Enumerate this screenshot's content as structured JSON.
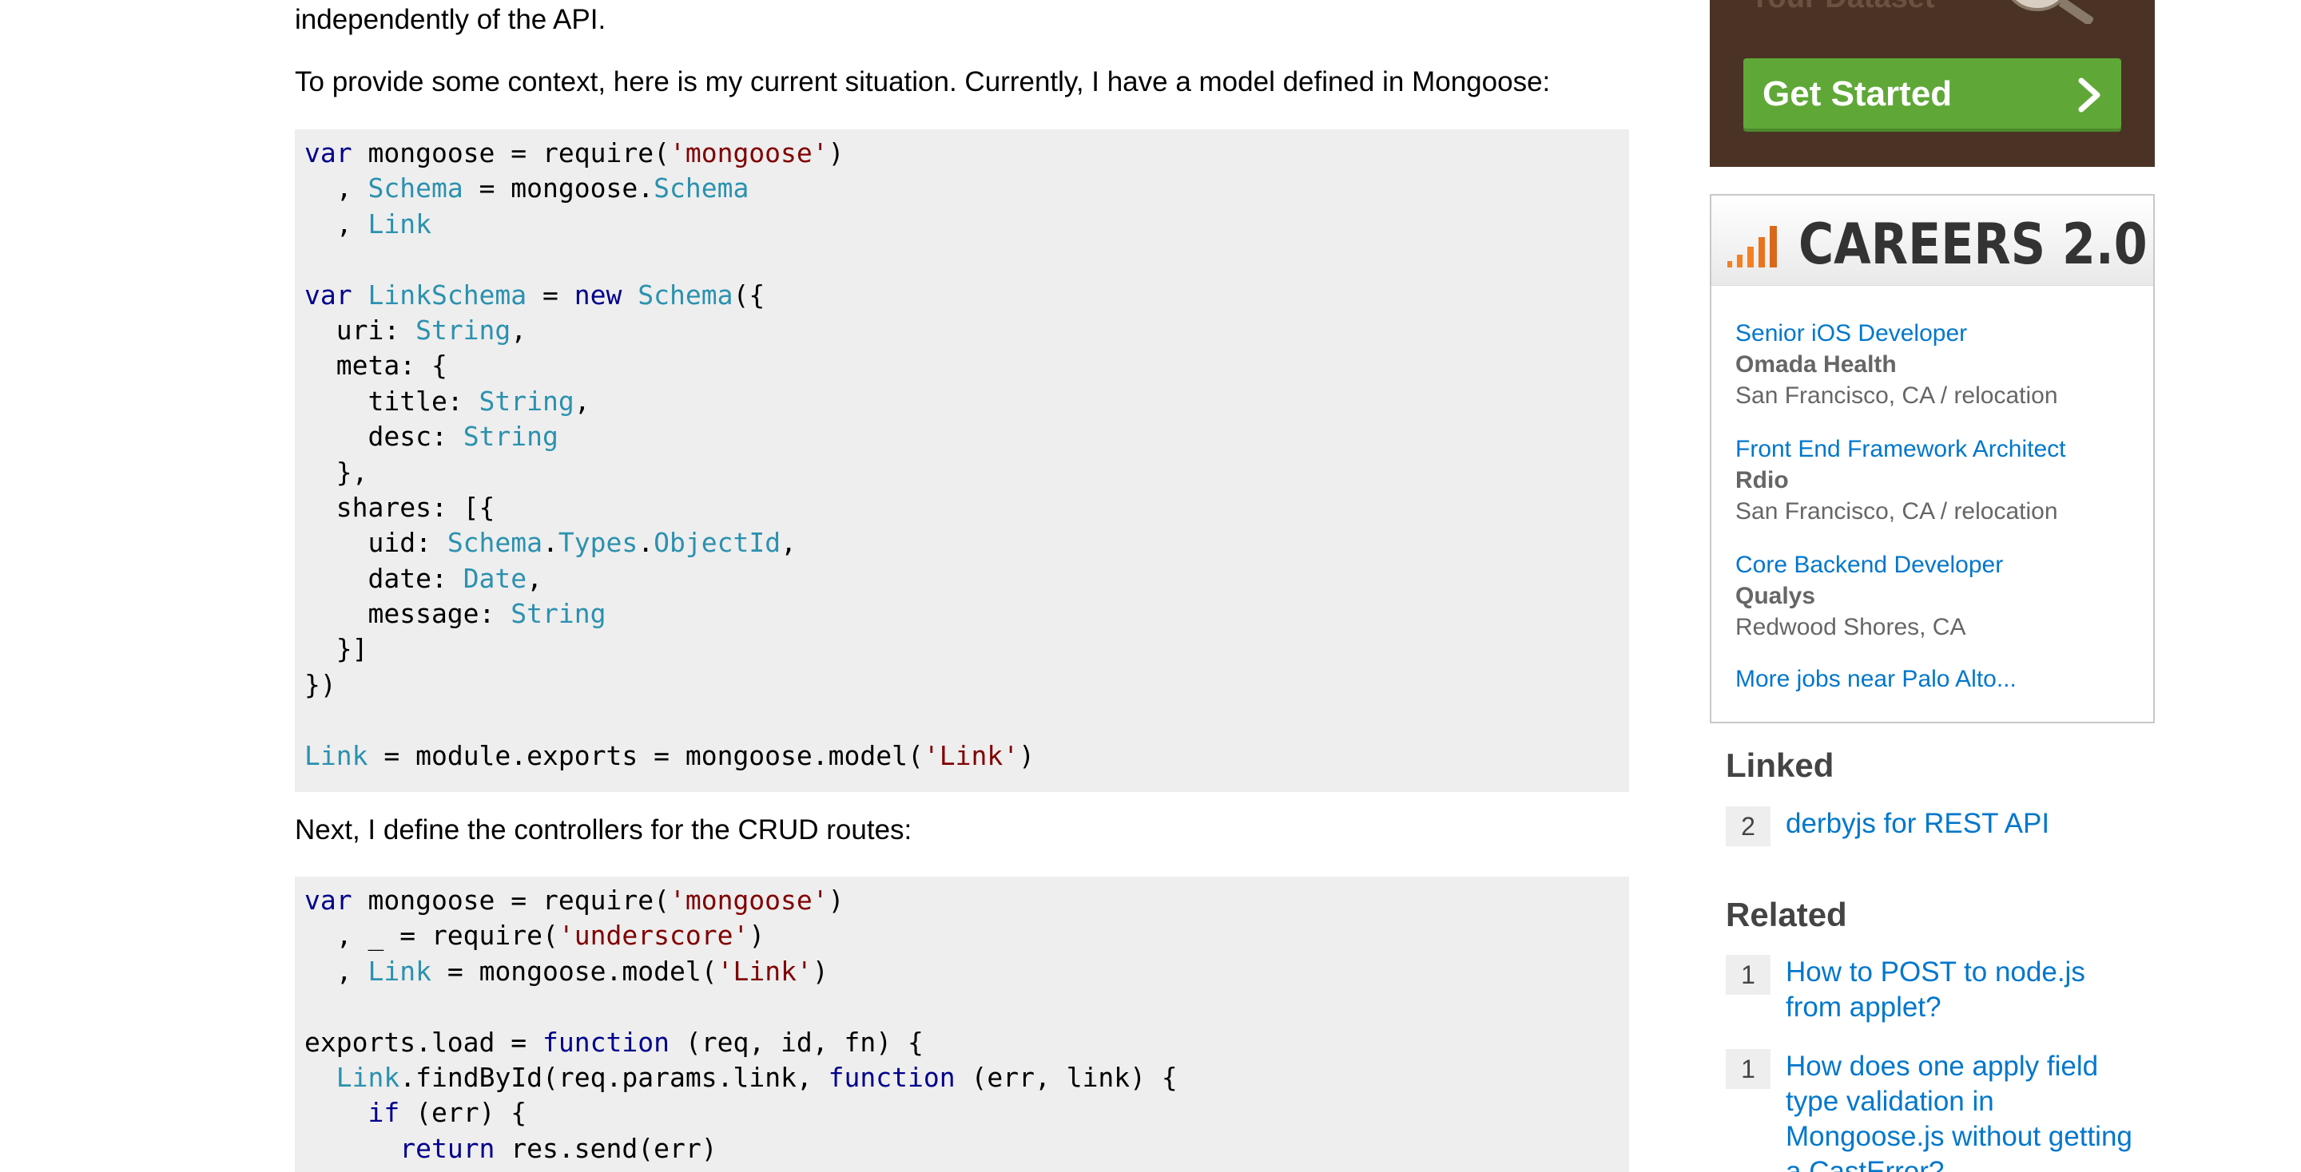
{
  "question": {
    "intro_tail": "independently of the API.",
    "context_paragraph": "To provide some context, here is my current situation. Currently, I have a model defined in Mongoose:",
    "controllers_paragraph": "Next, I define the controllers for the CRUD routes:"
  },
  "code_block_model": {
    "lines": [
      [
        [
          "kw",
          "var"
        ],
        [
          "p",
          " mongoose = require("
        ],
        [
          "str",
          "'mongoose'"
        ],
        [
          "p",
          ")"
        ]
      ],
      [
        [
          "p",
          "  , "
        ],
        [
          "ty",
          "Schema"
        ],
        [
          "p",
          " = mongoose."
        ],
        [
          "ty",
          "Schema"
        ]
      ],
      [
        [
          "p",
          "  , "
        ],
        [
          "ty",
          "Link"
        ]
      ],
      [],
      [
        [
          "kw",
          "var"
        ],
        [
          "p",
          " "
        ],
        [
          "ty",
          "LinkSchema"
        ],
        [
          "p",
          " = "
        ],
        [
          "kw",
          "new"
        ],
        [
          "p",
          " "
        ],
        [
          "ty",
          "Schema"
        ],
        [
          "p",
          "({"
        ]
      ],
      [
        [
          "p",
          "  uri: "
        ],
        [
          "ty",
          "String"
        ],
        [
          "p",
          ","
        ]
      ],
      [
        [
          "p",
          "  meta: {"
        ]
      ],
      [
        [
          "p",
          "    title: "
        ],
        [
          "ty",
          "String"
        ],
        [
          "p",
          ","
        ]
      ],
      [
        [
          "p",
          "    desc: "
        ],
        [
          "ty",
          "String"
        ]
      ],
      [
        [
          "p",
          "  },"
        ]
      ],
      [
        [
          "p",
          "  shares: [{"
        ]
      ],
      [
        [
          "p",
          "    uid: "
        ],
        [
          "ty",
          "Schema"
        ],
        [
          "p",
          "."
        ],
        [
          "ty",
          "Types"
        ],
        [
          "p",
          "."
        ],
        [
          "ty",
          "ObjectId"
        ],
        [
          "p",
          ","
        ]
      ],
      [
        [
          "p",
          "    date: "
        ],
        [
          "ty",
          "Date"
        ],
        [
          "p",
          ","
        ]
      ],
      [
        [
          "p",
          "    message: "
        ],
        [
          "ty",
          "String"
        ]
      ],
      [
        [
          "p",
          "  }]"
        ]
      ],
      [
        [
          "p",
          "})"
        ]
      ],
      [],
      [
        [
          "ty",
          "Link"
        ],
        [
          "p",
          " = module.exports = mongoose.model("
        ],
        [
          "str",
          "'Link'"
        ],
        [
          "p",
          ")"
        ]
      ]
    ]
  },
  "code_block_controllers": {
    "lines": [
      [
        [
          "kw",
          "var"
        ],
        [
          "p",
          " mongoose = require("
        ],
        [
          "str",
          "'mongoose'"
        ],
        [
          "p",
          ")"
        ]
      ],
      [
        [
          "p",
          "  , _ = require("
        ],
        [
          "str",
          "'underscore'"
        ],
        [
          "p",
          ")"
        ]
      ],
      [
        [
          "p",
          "  , "
        ],
        [
          "ty",
          "Link"
        ],
        [
          "p",
          " = mongoose.model("
        ],
        [
          "str",
          "'Link'"
        ],
        [
          "p",
          ")"
        ]
      ],
      [],
      [
        [
          "p",
          "exports.load = "
        ],
        [
          "kw",
          "function"
        ],
        [
          "p",
          " (req, id, fn) {"
        ]
      ],
      [
        [
          "p",
          "  "
        ],
        [
          "ty",
          "Link"
        ],
        [
          "p",
          ".findById(req.params.link, "
        ],
        [
          "kw",
          "function"
        ],
        [
          "p",
          " (err, link) {"
        ]
      ],
      [
        [
          "p",
          "    "
        ],
        [
          "kw",
          "if"
        ],
        [
          "p",
          " (err) {"
        ]
      ],
      [
        [
          "p",
          "      "
        ],
        [
          "kw",
          "return"
        ],
        [
          "p",
          " res.send(err)"
        ]
      ],
      [
        [
          "p",
          "    }"
        ]
      ]
    ]
  },
  "ad": {
    "partial_heading": "Your Dataset",
    "button_label": "Get Started",
    "button_icon": "chevron-right-icon",
    "background_color": "#4a3324",
    "button_color": "#5fa838"
  },
  "careers": {
    "title": "CAREERS 2.0",
    "logo_icon": "signal-bars-icon",
    "jobs": [
      {
        "title": "Senior iOS Developer",
        "company": "Omada Health",
        "location": "San Francisco, CA / relocation"
      },
      {
        "title": "Front End Framework Architect",
        "company": "Rdio",
        "location": "San Francisco, CA / relocation"
      },
      {
        "title": "Core Backend Developer",
        "company": "Qualys",
        "location": "Redwood Shores, CA"
      }
    ],
    "more_jobs": "More jobs near Palo Alto..."
  },
  "linked": {
    "heading": "Linked",
    "items": [
      {
        "count": "2",
        "title": "derbyjs for REST API"
      }
    ]
  },
  "related": {
    "heading": "Related",
    "items": [
      {
        "count": "1",
        "title": "How to POST to node.js from applet?"
      },
      {
        "count": "1",
        "title": "How does one apply field type validation in Mongoose.js without getting a CastError?"
      }
    ]
  },
  "colors": {
    "link": "#0077cc",
    "code_background": "#eeeeee",
    "code_keyword": "#00008b",
    "code_type": "#2b91af",
    "code_string": "#800000"
  }
}
